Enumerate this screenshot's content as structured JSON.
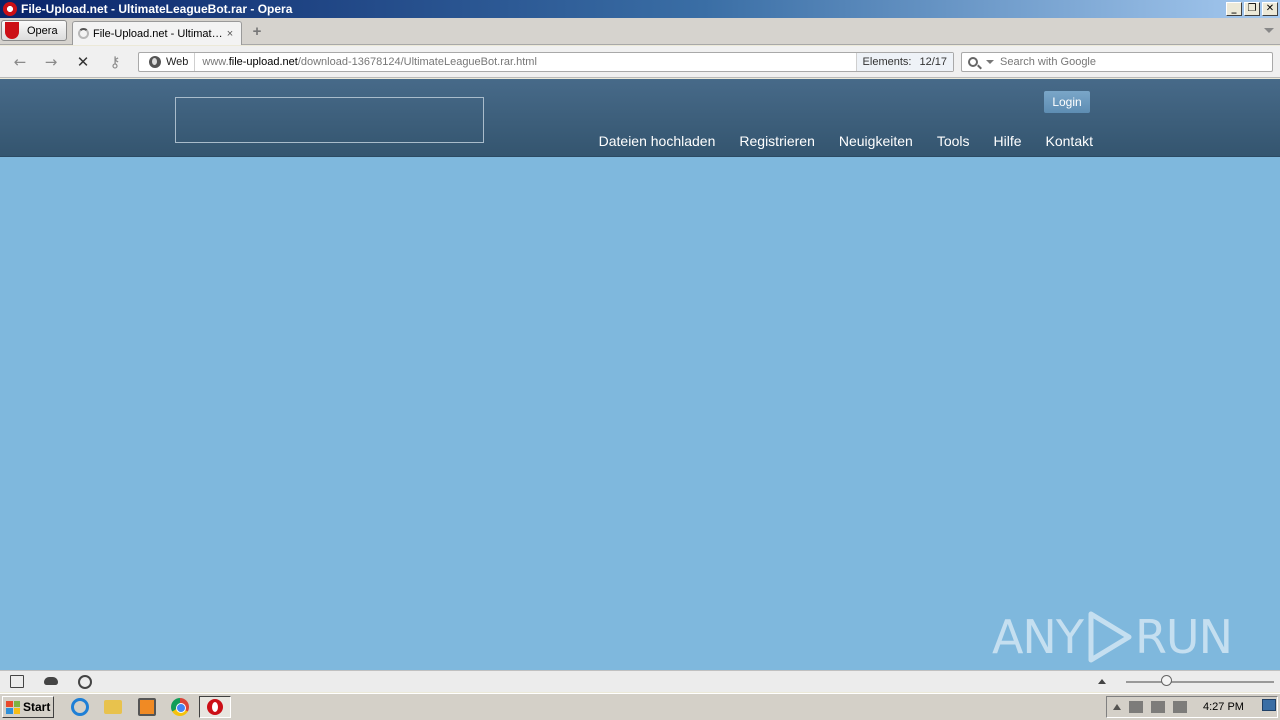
{
  "window": {
    "title": "File-Upload.net - UltimateLeagueBot.rar - Opera",
    "controls": [
      "_",
      "❐",
      "✕"
    ]
  },
  "browser": {
    "menu_label": "Opera",
    "tab": {
      "title": "File-Upload.net - Ultimat…",
      "close": "×"
    },
    "new_tab": "+",
    "address": {
      "badge": "Web",
      "url_prefix": "www.",
      "url_domain": "file-upload.net",
      "url_path": "/download-13678124/UltimateLeagueBot.rar.html",
      "elements_label": "Elements:",
      "elements_count": "12/17"
    },
    "search": {
      "placeholder": "Search with Google"
    },
    "nav_icons": {
      "back": "←",
      "forward": "→",
      "stop": "✕",
      "key": "⚷"
    }
  },
  "site": {
    "login_label": "Login",
    "nav": [
      {
        "label": "Dateien hochladen"
      },
      {
        "label": "Registrieren"
      },
      {
        "label": "Neuigkeiten"
      },
      {
        "label": "Tools"
      },
      {
        "label": "Hilfe"
      },
      {
        "label": "Kontakt"
      }
    ],
    "colors": {
      "header": "#3f6180",
      "body": "#7fb8dd",
      "login": "#6a97bd"
    }
  },
  "watermark": {
    "left": "ANY",
    "right": "RUN"
  },
  "taskbar": {
    "start_label": "Start",
    "clock": "4:27 PM"
  }
}
